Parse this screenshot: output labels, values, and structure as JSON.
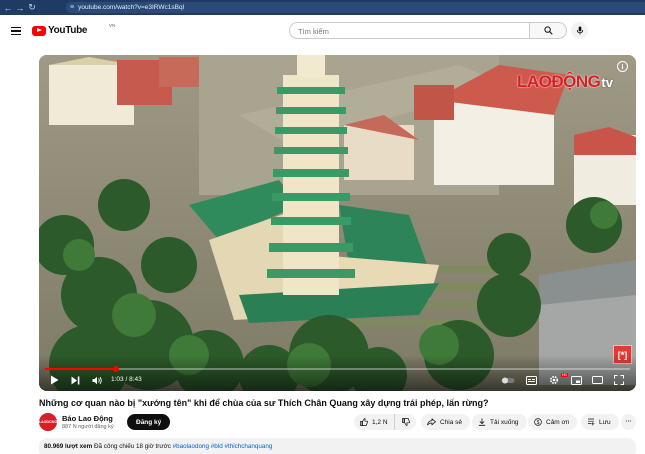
{
  "browser": {
    "url": "youtube.com/watch?v=e3IRWc1sBql"
  },
  "header": {
    "logo_text": "YouTube",
    "country_code": "VN",
    "search_placeholder": "Tìm kiếm"
  },
  "player": {
    "watermark_main": "LAOĐỘNG",
    "watermark_suffix": "tv",
    "info_glyph": "i",
    "badge_glyph": "[*]",
    "time": "1:03 / 8:43",
    "progress_fraction": 0.122,
    "hd_label": "HD"
  },
  "video": {
    "title": "Những cơ quan nào bị \"xướng tên\" khi để chùa của sư Thích Chân Quang xây dựng trái phép, lấn rừng?"
  },
  "channel": {
    "avatar_text": "LAODONG",
    "name": "Báo Lao Động",
    "subscribers": "887 N người đăng ký",
    "subscribe_label": "Đăng ký"
  },
  "actions": {
    "likes": "1,2 N",
    "share": "Chia sẻ",
    "download": "Tải xuống",
    "thanks": "Cảm ơn",
    "save": "Lưu",
    "more": "···"
  },
  "description": {
    "views": "80.969 lượt xem",
    "premiered": "Đã công chiếu 18 giờ trước",
    "hashtags": "#baolaodong #bld #thichchanquang"
  },
  "icons": {
    "back": "back-arrow-icon",
    "forward": "forward-arrow-icon",
    "reload": "reload-icon",
    "menu": "menu-icon",
    "search": "search-icon",
    "mic": "mic-icon",
    "play": "play-icon",
    "next": "next-icon",
    "volume": "volume-icon",
    "like": "thumbs-up-icon",
    "dislike": "thumbs-down-icon",
    "share": "share-icon",
    "download": "download-icon",
    "thanks": "thanks-icon",
    "save": "save-icon"
  },
  "colors": {
    "brand_red": "#ff0000",
    "browser_bar": "#1f3b64",
    "link_blue": "#065fd4",
    "watermark_red": "#d81f26"
  }
}
